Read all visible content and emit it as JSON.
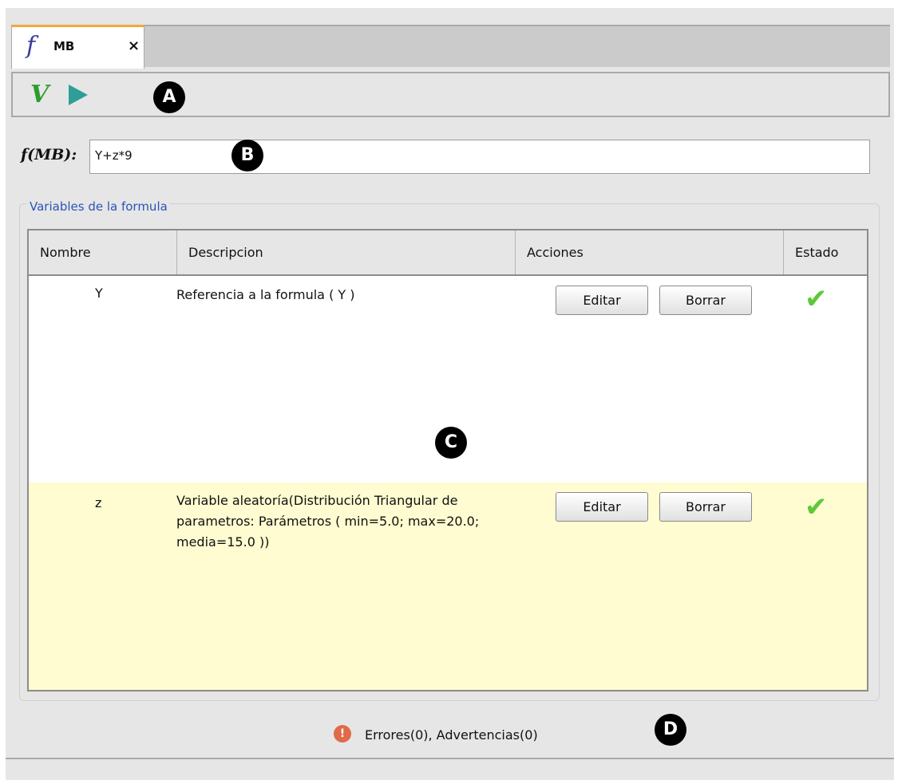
{
  "tab": {
    "icon": "f",
    "label": "MB",
    "close": "×"
  },
  "toolbar": {
    "validate_icon": "V",
    "run_icon": "play-icon"
  },
  "markers": {
    "a": "A",
    "b": "B",
    "c": "C",
    "d": "D"
  },
  "formula": {
    "label": "f(MB):",
    "value": "Y+z*9"
  },
  "variables": {
    "title": "Variables de la formula",
    "headers": [
      "Nombre",
      "Descripcion",
      "Acciones",
      "Estado"
    ],
    "rows": [
      {
        "name": "Y",
        "description": "Referencia a la formula ( Y )",
        "edit": "Editar",
        "delete": "Borrar",
        "status": "✔"
      },
      {
        "name": "z",
        "description": "Variable aleatoría(Distribución Triangular de parametros: Parámetros ( min=5.0; max=20.0; media=15.0 ))",
        "edit": "Editar",
        "delete": "Borrar",
        "status": "✔"
      }
    ]
  },
  "status": {
    "icon": "!",
    "text": "Errores(0), Advertencias(0)"
  },
  "colors": {
    "selected_row": "#fefcd0",
    "accent_tab": "#f0a83c",
    "title_blue": "#2a55b8"
  }
}
